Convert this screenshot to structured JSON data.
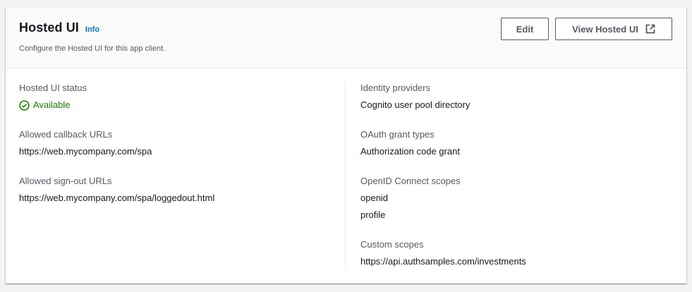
{
  "header": {
    "title": "Hosted UI",
    "info_label": "Info",
    "description": "Configure the Hosted UI for this app client.",
    "edit_label": "Edit",
    "view_label": "View Hosted UI"
  },
  "left": {
    "status_label": "Hosted UI status",
    "status_value": "Available",
    "callback_label": "Allowed callback URLs",
    "callback_value": "https://web.mycompany.com/spa",
    "signout_label": "Allowed sign-out URLs",
    "signout_value": "https://web.mycompany.com/spa/loggedout.html"
  },
  "right": {
    "idp_label": "Identity providers",
    "idp_value": "Cognito user pool directory",
    "grant_label": "OAuth grant types",
    "grant_value": "Authorization code grant",
    "oidc_label": "OpenID Connect scopes",
    "oidc_values": [
      "openid",
      "profile"
    ],
    "custom_label": "Custom scopes",
    "custom_value": "https://api.authsamples.com/investments"
  },
  "colors": {
    "link": "#0073bb",
    "success": "#1d8102",
    "text": "#16191f",
    "muted": "#545b64"
  },
  "icons": {
    "status": "check-circle-icon",
    "external": "external-link-icon"
  }
}
